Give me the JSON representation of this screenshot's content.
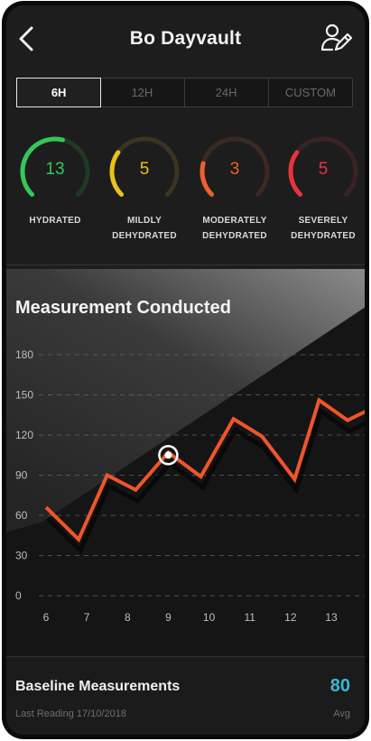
{
  "header": {
    "title": "Bo Dayvault",
    "back_icon": "chevron-left-icon",
    "edit_icon": "user-edit-icon"
  },
  "tabs": [
    "6H",
    "12H",
    "24H",
    "CUSTOM"
  ],
  "active_tab": "6H",
  "gauges": [
    {
      "value": "13",
      "label_line1": "HYDRATED",
      "label_line2": "",
      "color": "#34c759",
      "track": "#1f3a23",
      "fill": 0.55
    },
    {
      "value": "5",
      "label_line1": "MILDLY",
      "label_line2": "DEHYDRATED",
      "color": "#e8c21a",
      "track": "#3a3420",
      "fill": 0.3
    },
    {
      "value": "3",
      "label_line1": "MODERATELY",
      "label_line2": "DEHYDRATED",
      "color": "#f0602a",
      "track": "#3a2a22",
      "fill": 0.22
    },
    {
      "value": "5",
      "label_line1": "SEVERELY",
      "label_line2": "DEHYDRATED",
      "color": "#e8333a",
      "track": "#3a2224",
      "fill": 0.3
    }
  ],
  "chart_data": {
    "type": "line",
    "title": "Measurement Conducted",
    "x_ticks": [
      "6",
      "7",
      "8",
      "9",
      "10",
      "11",
      "12",
      "13"
    ],
    "y_ticks": [
      "0",
      "30",
      "60",
      "90",
      "120",
      "150",
      "180"
    ],
    "ylim": [
      0,
      180
    ],
    "x_range": [
      6,
      14.4
    ],
    "series": [
      {
        "color": "#f0552a",
        "x": [
          6,
          6.8,
          7.5,
          8.2,
          9,
          9.8,
          10.6,
          11.3,
          12.1,
          12.7,
          13.4,
          14.0,
          14.4
        ],
        "y": [
          66,
          42,
          90,
          79,
          107,
          89,
          132,
          119,
          87,
          146,
          131,
          140,
          131
        ]
      }
    ],
    "highlight": {
      "x": 9,
      "y": 105
    },
    "grid": true
  },
  "footer": {
    "title": "Baseline Measurements",
    "last_reading": "Last Reading 17/10/2018",
    "avg_value": "80",
    "avg_label": "Avg"
  }
}
